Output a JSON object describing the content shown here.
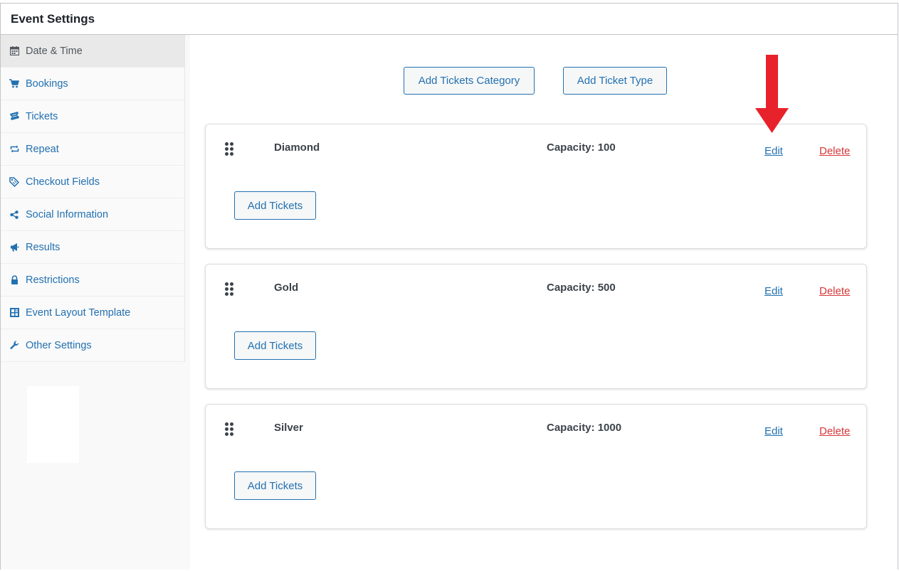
{
  "header": {
    "title": "Event Settings"
  },
  "sidebar": {
    "items": [
      {
        "label": "Date & Time",
        "icon": "calendar-icon",
        "active": true
      },
      {
        "label": "Bookings",
        "icon": "cart-icon"
      },
      {
        "label": "Tickets",
        "icon": "ticket-icon"
      },
      {
        "label": "Repeat",
        "icon": "repeat-icon"
      },
      {
        "label": "Checkout Fields",
        "icon": "tag-icon"
      },
      {
        "label": "Social Information",
        "icon": "share-icon"
      },
      {
        "label": "Results",
        "icon": "megaphone-icon"
      },
      {
        "label": "Restrictions",
        "icon": "lock-icon"
      },
      {
        "label": "Event Layout Template",
        "icon": "layout-icon"
      },
      {
        "label": "Other Settings",
        "icon": "wrench-icon"
      }
    ]
  },
  "toolbar": {
    "add_category_label": "Add Tickets Category",
    "add_type_label": "Add Ticket Type"
  },
  "categories": [
    {
      "name": "Diamond",
      "capacity": "Capacity: 100",
      "edit_label": "Edit",
      "delete_label": "Delete",
      "add_label": "Add Tickets"
    },
    {
      "name": "Gold",
      "capacity": "Capacity: 500",
      "edit_label": "Edit",
      "delete_label": "Delete",
      "add_label": "Add Tickets"
    },
    {
      "name": "Silver",
      "capacity": "Capacity: 1000",
      "edit_label": "Edit",
      "delete_label": "Delete",
      "add_label": "Add Tickets"
    }
  ],
  "annotation": {
    "arrow_color": "#e8222a",
    "points_to": "Edit"
  },
  "colors": {
    "link": "#2271b1",
    "danger": "#d63638",
    "border": "#c3c4c7"
  }
}
